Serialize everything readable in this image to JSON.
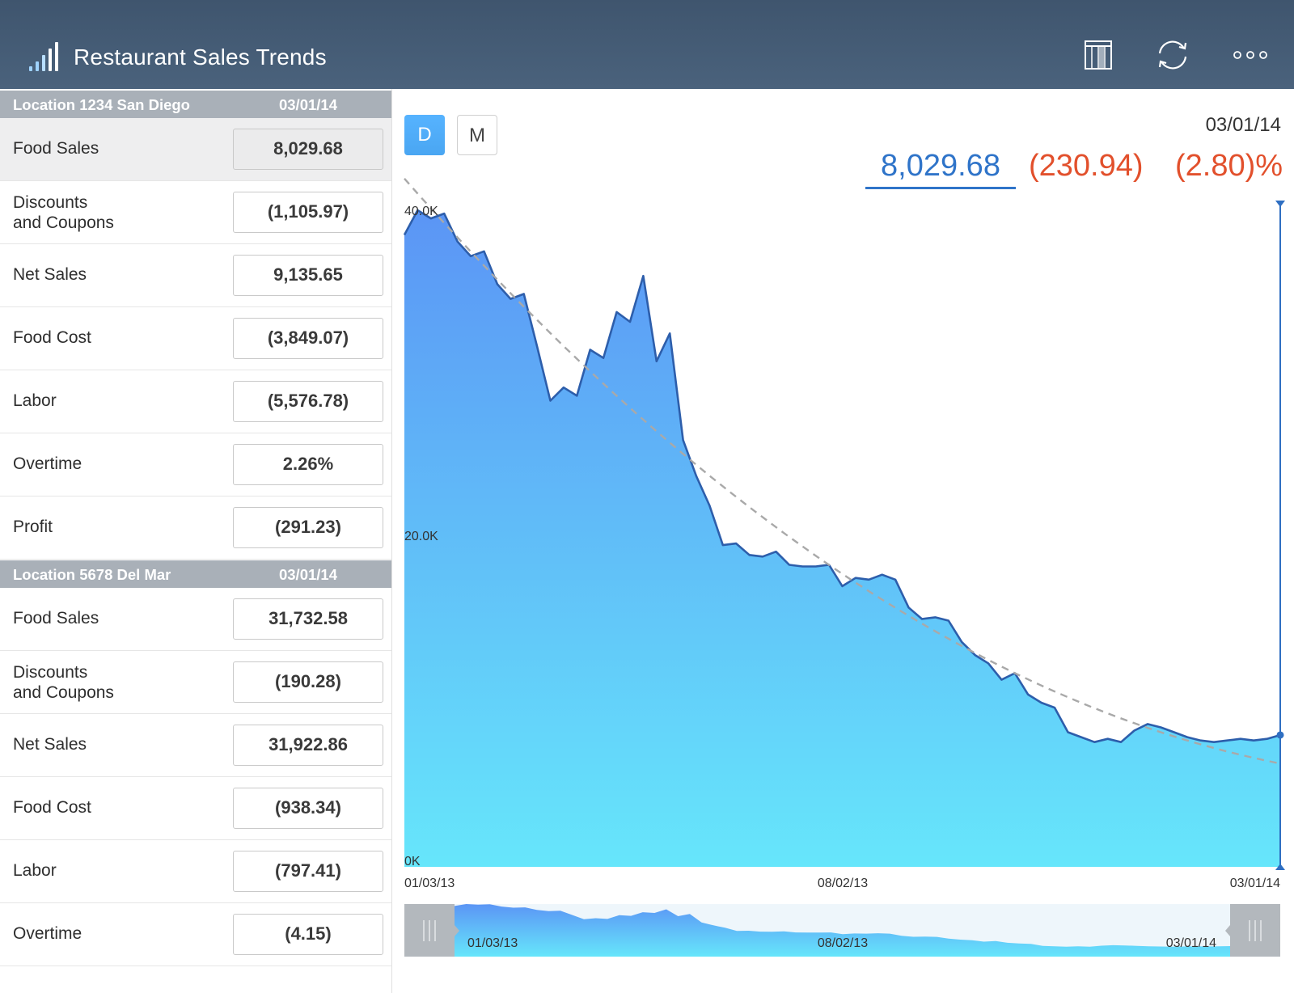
{
  "app": {
    "title": "Restaurant Sales Trends"
  },
  "toolbar": {
    "icons": [
      "bar-chart-logo-icon",
      "columns-icon",
      "refresh-icon",
      "more-icon"
    ]
  },
  "locations": [
    {
      "name": "Location 1234 San Diego",
      "date": "03/01/14",
      "rows": [
        {
          "label": "Food Sales",
          "value": "8,029.68"
        },
        {
          "label": "Discounts\nand Coupons",
          "value": "(1,105.97)"
        },
        {
          "label": "Net Sales",
          "value": "9,135.65"
        },
        {
          "label": "Food Cost",
          "value": "(3,849.07)"
        },
        {
          "label": "Labor",
          "value": "(5,576.78)"
        },
        {
          "label": "Overtime",
          "value": "2.26%"
        },
        {
          "label": "Profit",
          "value": "(291.23)"
        }
      ]
    },
    {
      "name": "Location 5678 Del Mar",
      "date": "03/01/14",
      "rows": [
        {
          "label": "Food Sales",
          "value": "31,732.58"
        },
        {
          "label": "Discounts\nand Coupons",
          "value": "(190.28)"
        },
        {
          "label": "Net Sales",
          "value": "31,922.86"
        },
        {
          "label": "Food Cost",
          "value": "(938.34)"
        },
        {
          "label": "Labor",
          "value": "(797.41)"
        },
        {
          "label": "Overtime",
          "value": "(4.15)"
        }
      ]
    }
  ],
  "chart_panel": {
    "mode_buttons": [
      "D",
      "M"
    ],
    "selected_mode": "D",
    "selected_date": "03/01/14",
    "selected_value": "8,029.68",
    "change": "(230.94)",
    "change_pct": "(2.80)%"
  },
  "colors": {
    "header_bg": "#445b74",
    "accent_blue": "#2f74c9",
    "negative_red": "#e2502c",
    "area_top": "#5b95f5",
    "area_bottom": "#66e6fb",
    "line": "#2d5eab"
  },
  "chart_data": {
    "type": "area",
    "x_tick_labels": [
      "01/03/13",
      "08/02/13",
      "03/01/14"
    ],
    "y_tick_labels": [
      "0K",
      "20.0K",
      "40.0K"
    ],
    "ylim": [
      0,
      40000
    ],
    "grid": false,
    "trend_line": "dashed grey",
    "series": [
      {
        "values": [
          38500,
          40000,
          39500,
          39800,
          38100,
          37200,
          37500,
          35500,
          34600,
          34900,
          31700,
          28400,
          29200,
          28700,
          31500,
          31000,
          33800,
          33200,
          36000,
          30800,
          32500,
          26000,
          23800,
          22000,
          19600,
          19700,
          19000,
          18900,
          19200,
          18400,
          18300,
          18300,
          18400,
          17100,
          17600,
          17500,
          17800,
          17500,
          15800,
          15100,
          15200,
          15000,
          13700,
          12900,
          12400,
          11400,
          11800,
          10500,
          10000,
          9700,
          8200,
          7900,
          7600,
          7800,
          7600,
          8300,
          8700,
          8500,
          8200,
          7900,
          7700,
          7600,
          7700,
          7800,
          7700,
          7800,
          8030
        ]
      }
    ],
    "x_range": [
      "01/03/13",
      "03/01/14"
    ],
    "navigator": {
      "x_tick_labels": [
        "01/03/13",
        "08/02/13",
        "03/01/14"
      ],
      "selection": "full range"
    }
  }
}
